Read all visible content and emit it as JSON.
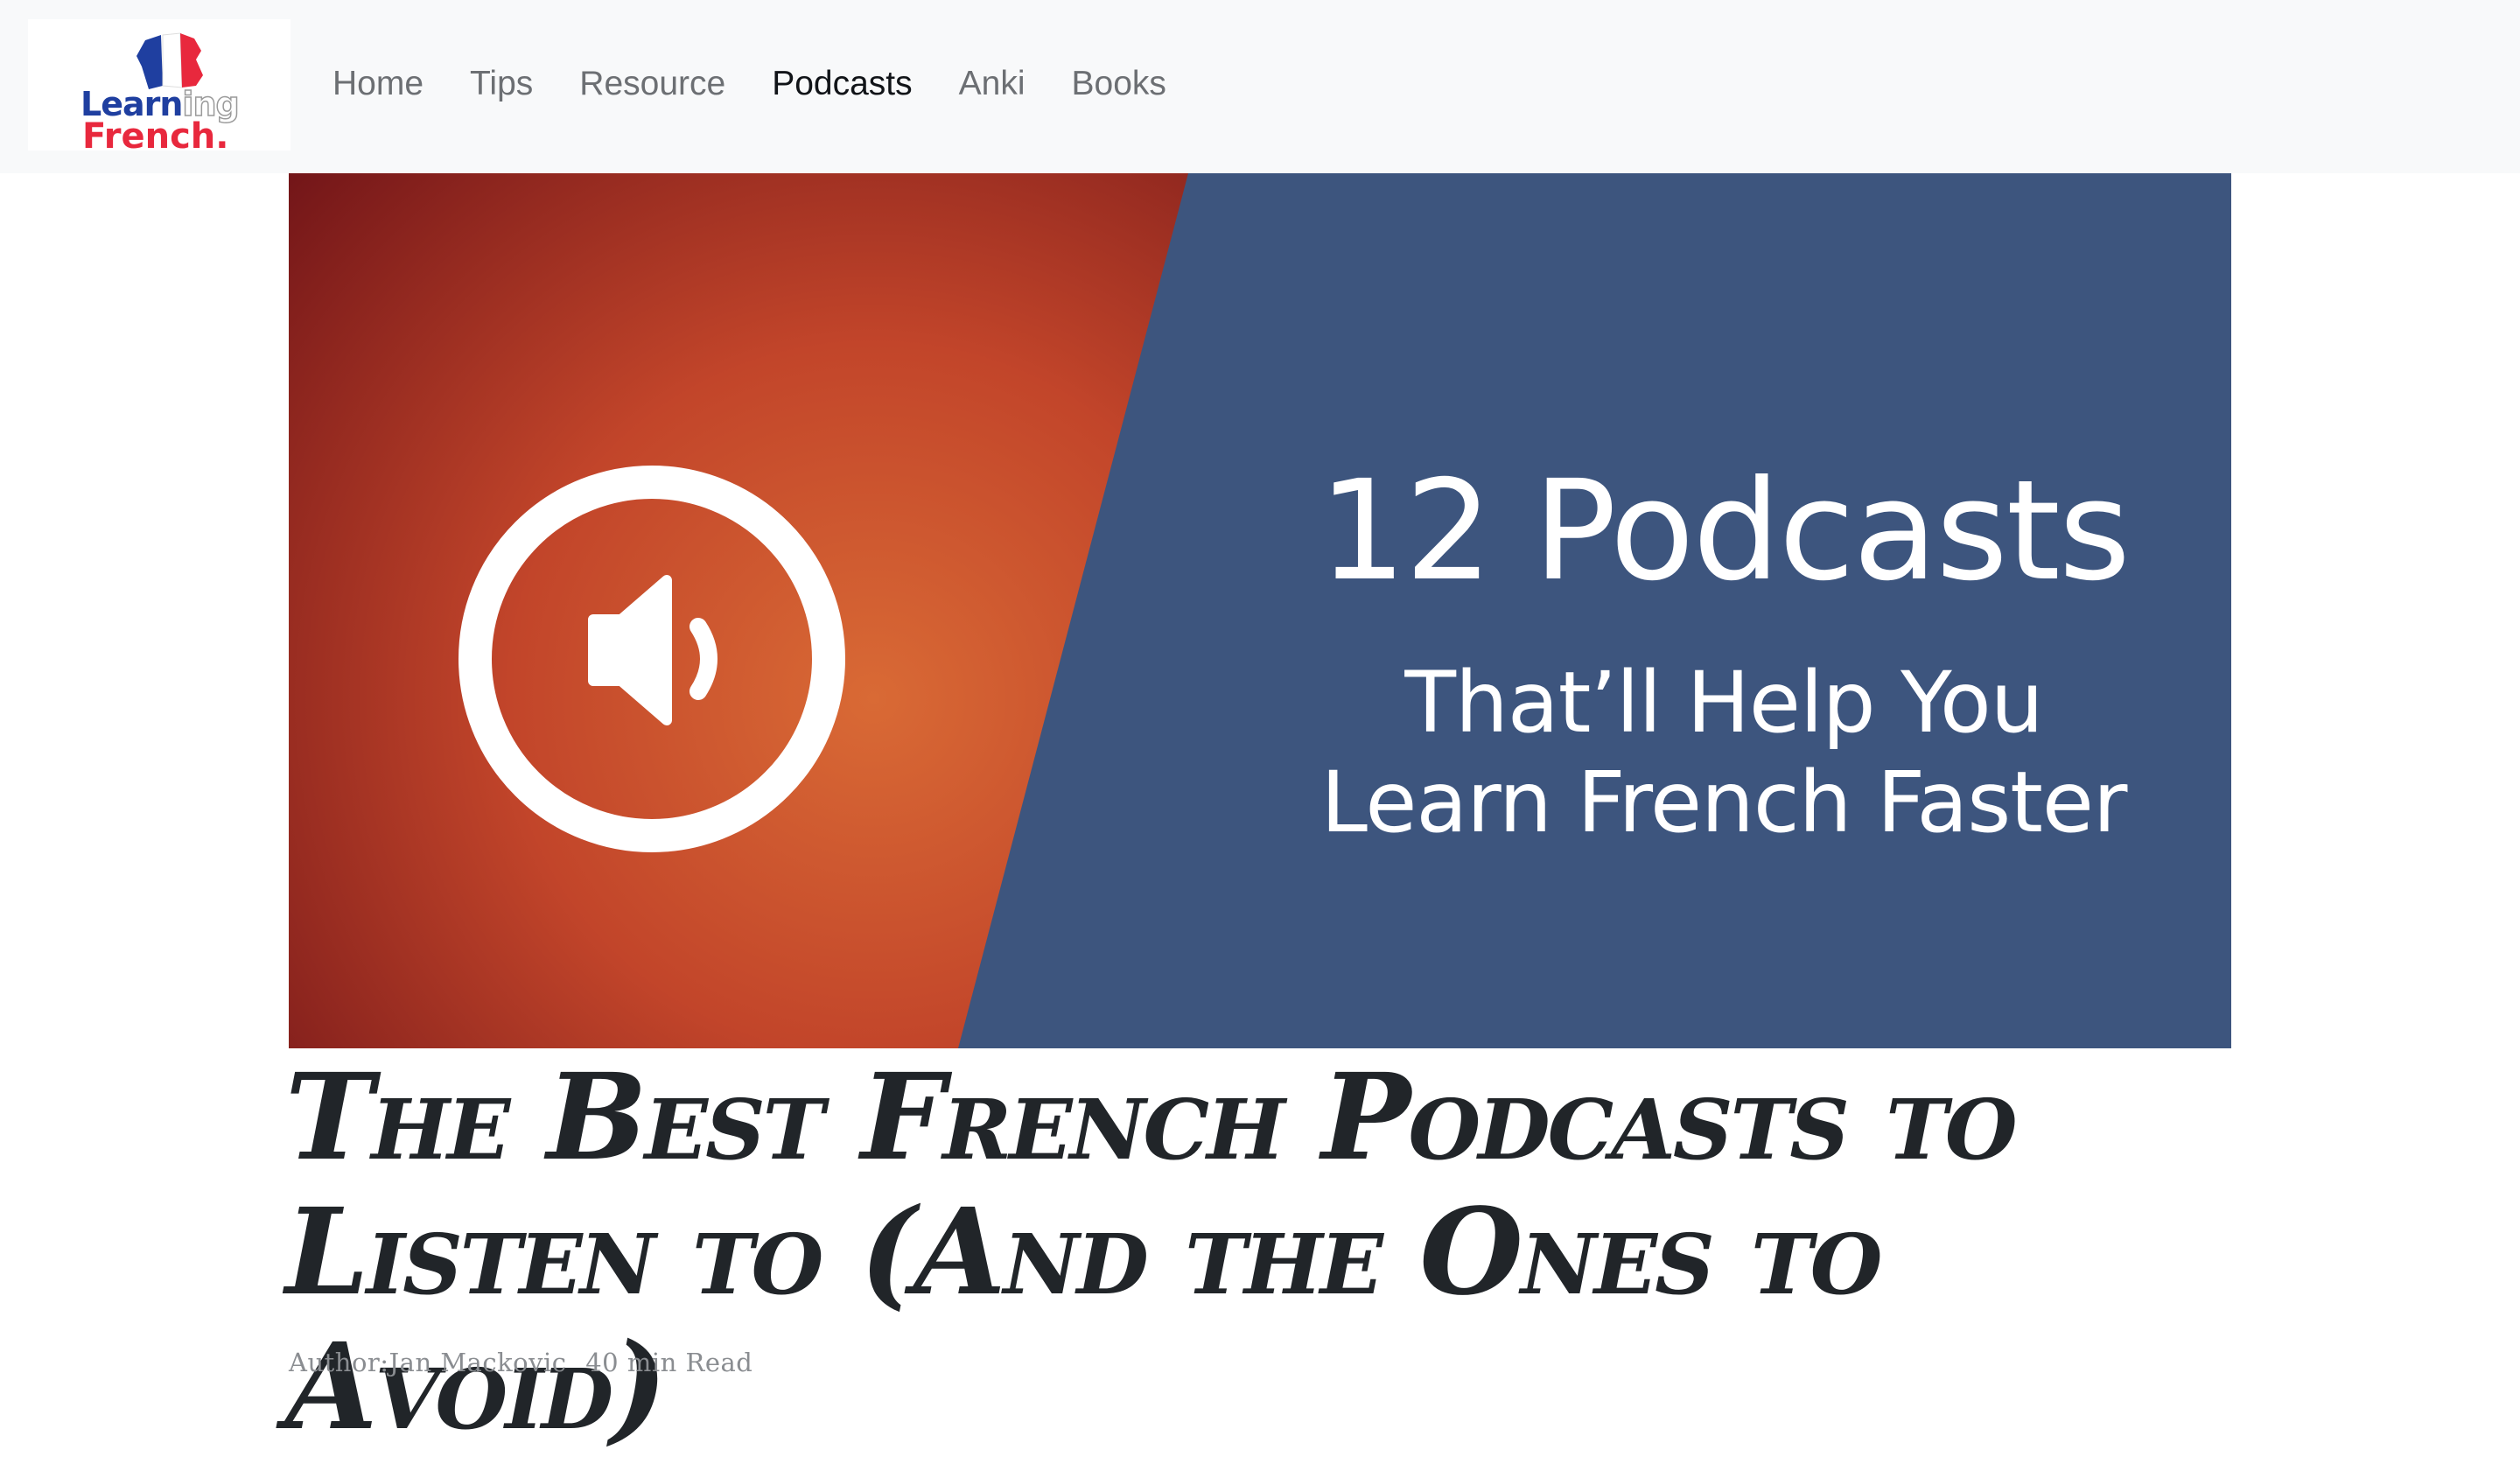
{
  "brand": {
    "logo_line1": "Learn",
    "logo_line1_suffix": "ing",
    "logo_line2": "French.",
    "colors": {
      "blue": "#1f3fa0",
      "red": "#e8283d"
    }
  },
  "nav": {
    "items": [
      {
        "label": "Home"
      },
      {
        "label": "Tips"
      },
      {
        "label": "Resource"
      },
      {
        "label": "Podcasts"
      },
      {
        "label": "Anki"
      },
      {
        "label": "Books"
      }
    ],
    "active": "Podcasts"
  },
  "hero": {
    "title": "12 Podcasts",
    "subtitle_line1": "That’ll Help You",
    "subtitle_line2": "Learn French Faster",
    "icon": "speaker-volume-icon",
    "colors": {
      "left": "#c44a2a",
      "right": "#3d557e"
    }
  },
  "article": {
    "title": "The Best French Podcasts to Listen to (And the Ones to Avoid)",
    "author": "Author:Jan Mackovic",
    "read_time": "40 min Read"
  }
}
